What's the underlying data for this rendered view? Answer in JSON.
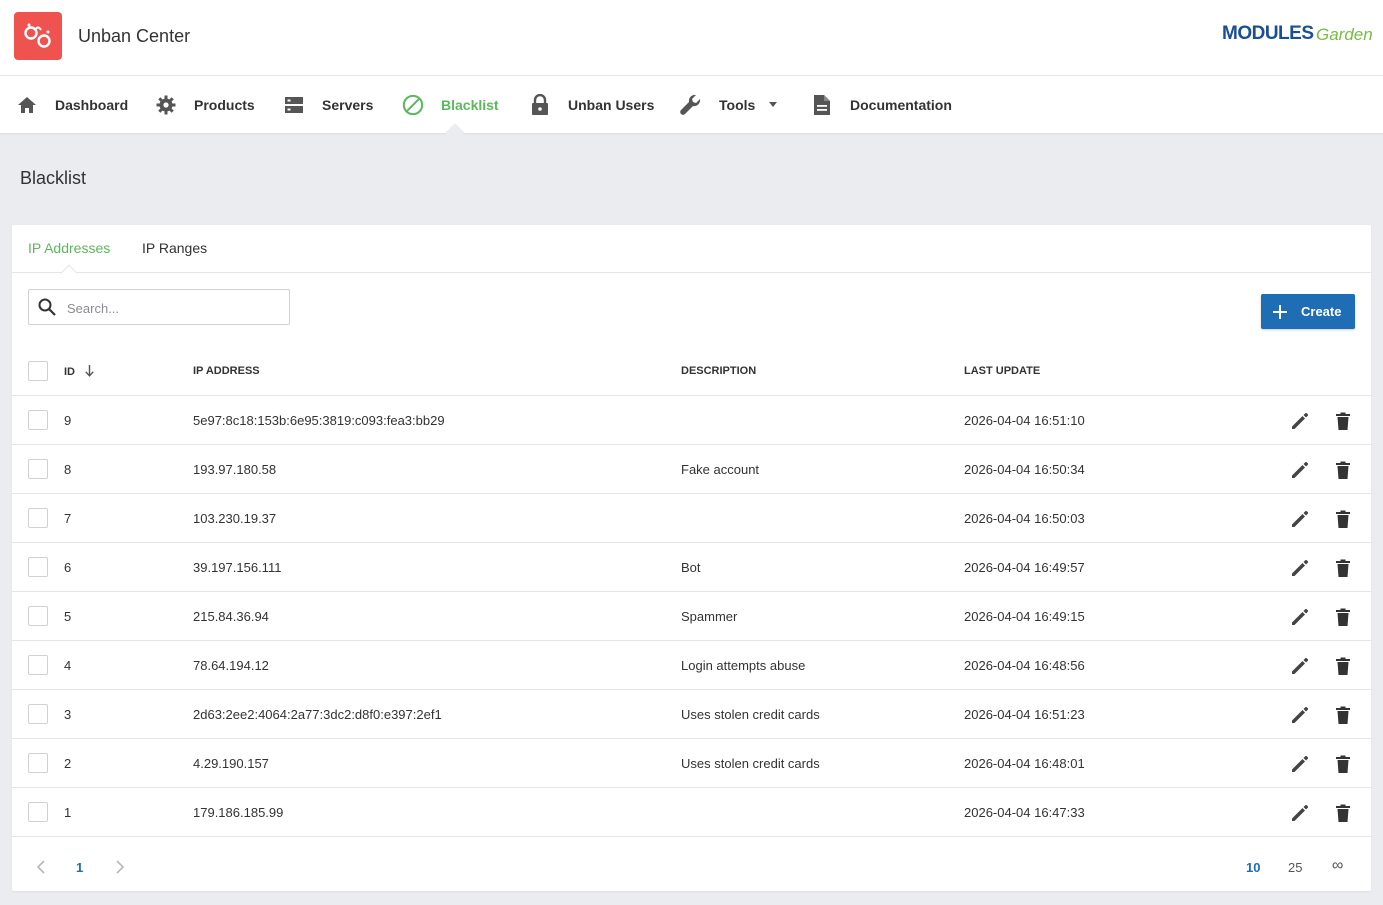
{
  "app": {
    "title": "Unban Center"
  },
  "brand": {
    "part1": "MODULES",
    "part2": "Garden"
  },
  "nav": {
    "items": [
      {
        "label": "Dashboard",
        "icon": "home-icon"
      },
      {
        "label": "Products",
        "icon": "gear-icon"
      },
      {
        "label": "Servers",
        "icon": "server-icon"
      },
      {
        "label": "Blacklist",
        "icon": "block-icon",
        "active": true
      },
      {
        "label": "Unban Users",
        "icon": "lock-icon"
      },
      {
        "label": "Tools",
        "icon": "wrench-icon",
        "dropdown": true
      },
      {
        "label": "Documentation",
        "icon": "document-icon"
      }
    ]
  },
  "page": {
    "title": "Blacklist"
  },
  "tabs": [
    {
      "label": "IP Addresses",
      "active": true
    },
    {
      "label": "IP Ranges"
    }
  ],
  "search": {
    "placeholder": "Search...",
    "value": ""
  },
  "create_button": {
    "label": "Create"
  },
  "table": {
    "columns": [
      "ID",
      "IP ADDRESS",
      "DESCRIPTION",
      "LAST UPDATE"
    ],
    "sort": {
      "column": "ID",
      "direction": "desc"
    },
    "rows": [
      {
        "id": "9",
        "ip": "5e97:8c18:153b:6e95:3819:c093:fea3:bb29",
        "description": "",
        "last_update": "2026-04-04 16:51:10"
      },
      {
        "id": "8",
        "ip": "193.97.180.58",
        "description": "Fake account",
        "last_update": "2026-04-04 16:50:34"
      },
      {
        "id": "7",
        "ip": "103.230.19.37",
        "description": "",
        "last_update": "2026-04-04 16:50:03"
      },
      {
        "id": "6",
        "ip": "39.197.156.111",
        "description": "Bot",
        "last_update": "2026-04-04 16:49:57"
      },
      {
        "id": "5",
        "ip": "215.84.36.94",
        "description": "Spammer",
        "last_update": "2026-04-04 16:49:15"
      },
      {
        "id": "4",
        "ip": "78.64.194.12",
        "description": "Login attempts abuse",
        "last_update": "2026-04-04 16:48:56"
      },
      {
        "id": "3",
        "ip": "2d63:2ee2:4064:2a77:3dc2:d8f0:e397:2ef1",
        "description": "Uses stolen credit cards",
        "last_update": "2026-04-04 16:51:23"
      },
      {
        "id": "2",
        "ip": "4.29.190.157",
        "description": "Uses stolen credit cards",
        "last_update": "2026-04-04 16:48:01"
      },
      {
        "id": "1",
        "ip": "179.186.185.99",
        "description": "",
        "last_update": "2026-04-04 16:47:33"
      }
    ]
  },
  "pagination": {
    "current_page": "1",
    "page_sizes": [
      "10",
      "25",
      "∞"
    ],
    "selected_size": "10"
  },
  "colors": {
    "accent": "#5cb85c",
    "primary": "#1f6db5",
    "logo_bg": "#ef5350"
  }
}
